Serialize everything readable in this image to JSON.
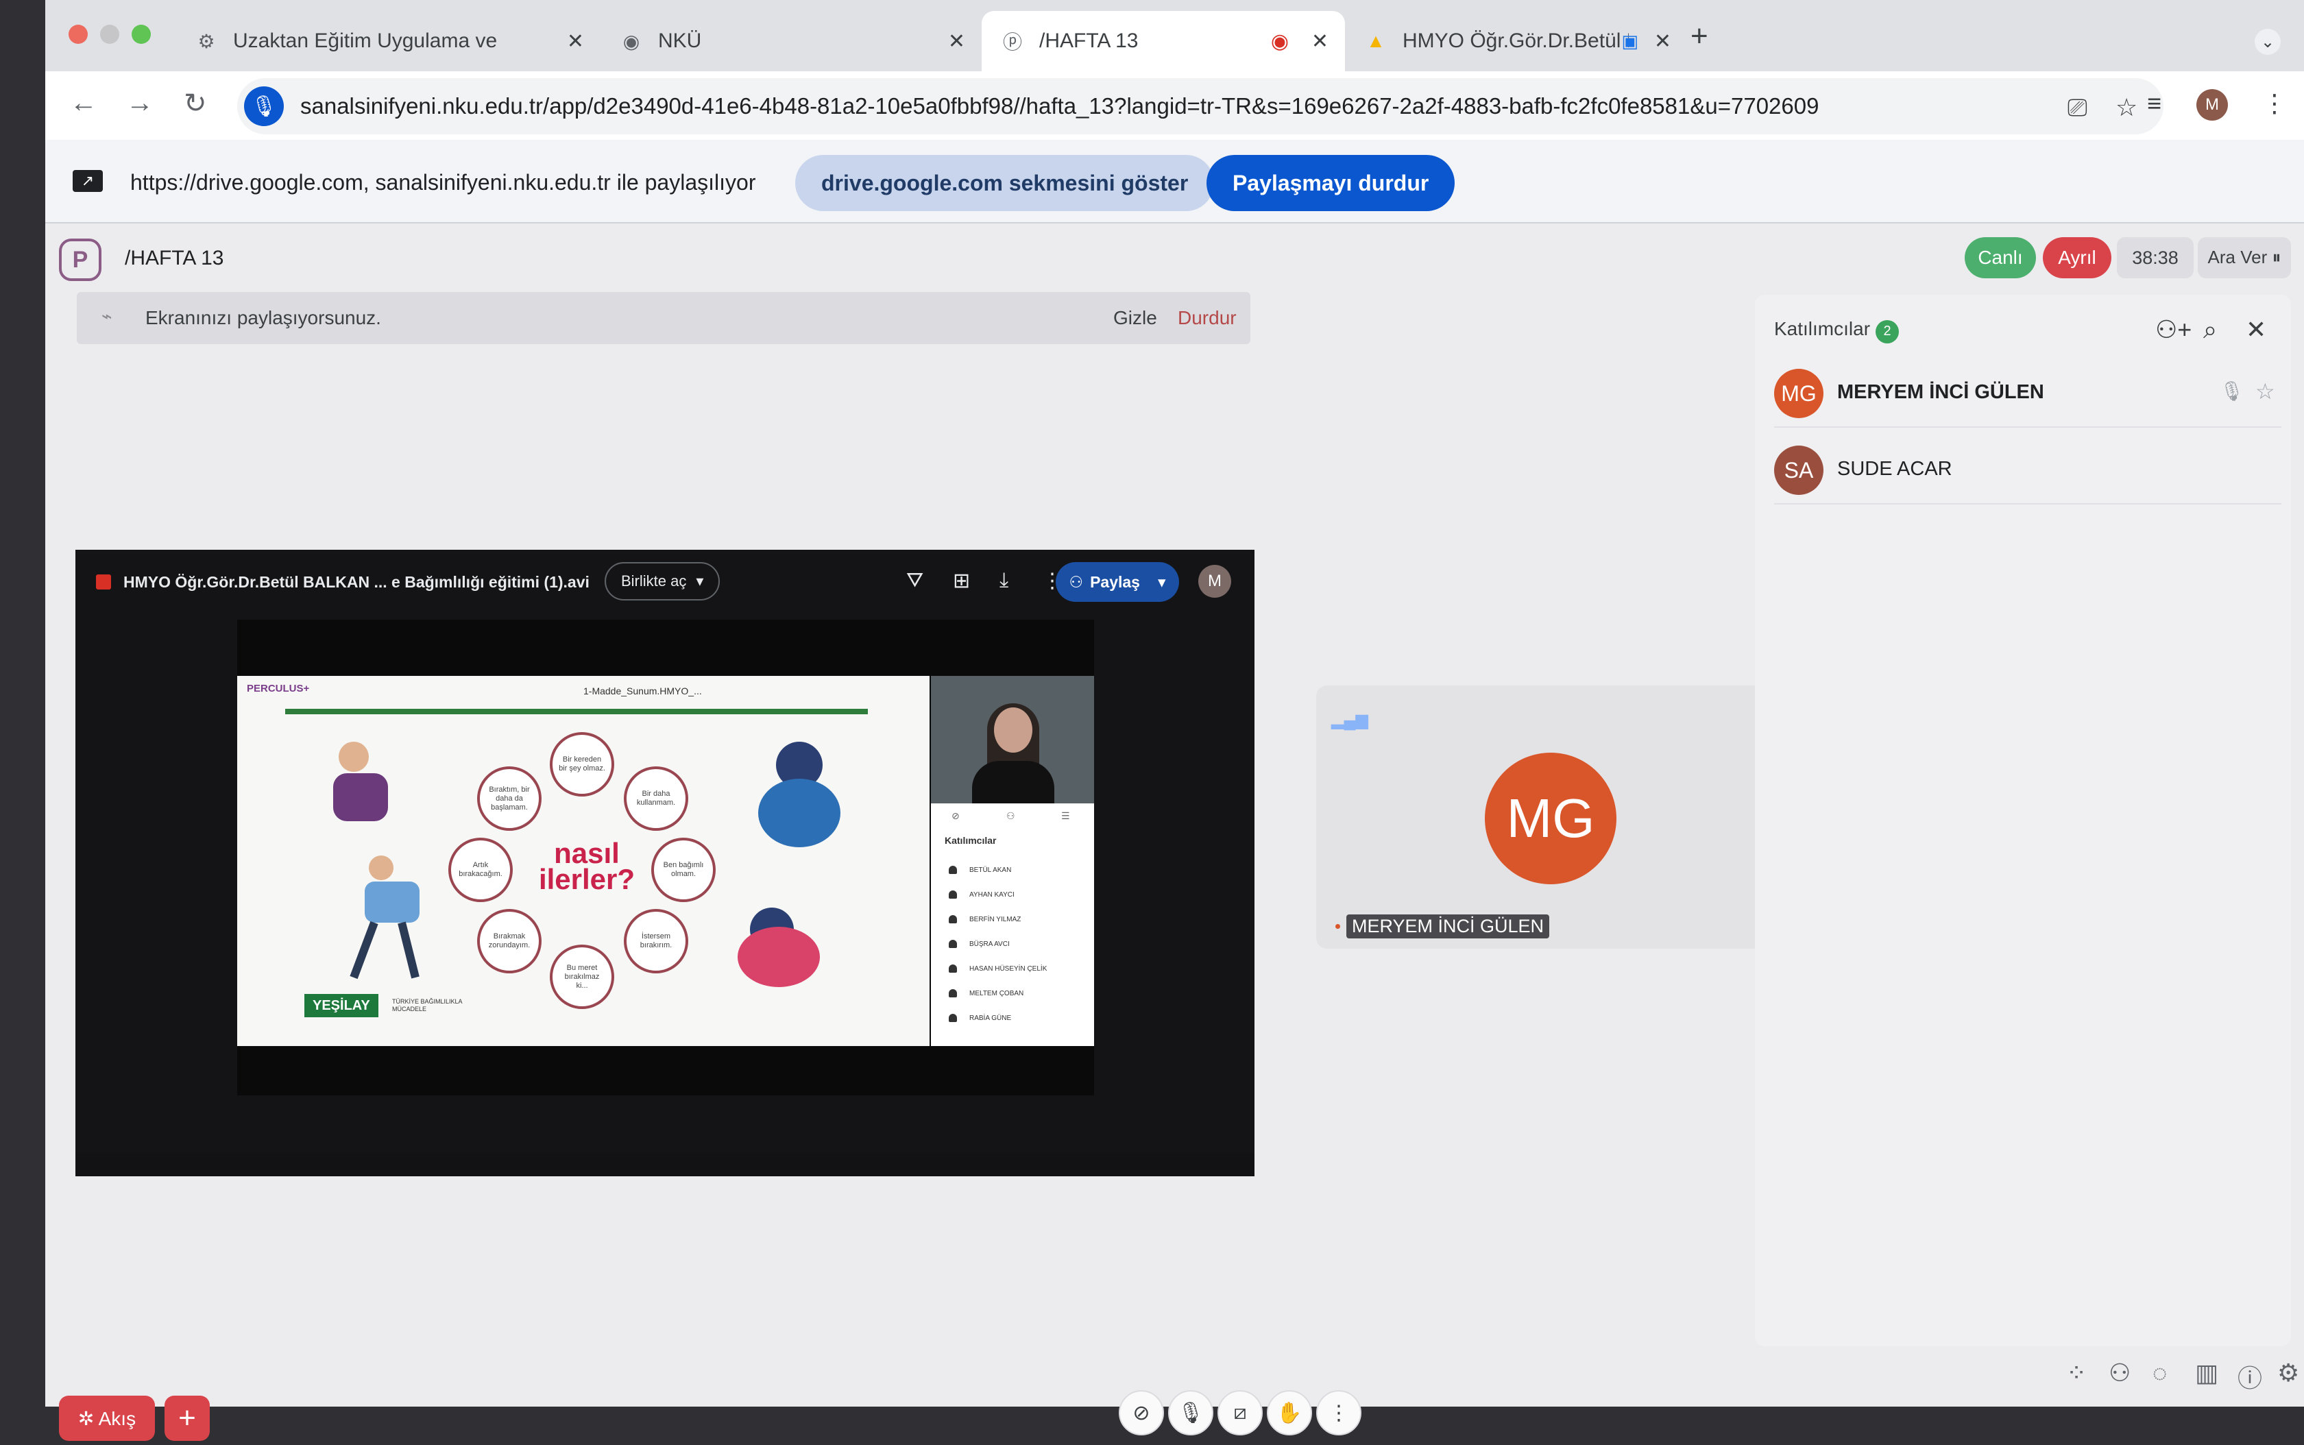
{
  "window": {
    "traffic_colors": [
      "#ed6a5e",
      "#c6c6c8",
      "#c6c6c8"
    ]
  },
  "tabs": [
    {
      "label": "Uzaktan Eğitim Uygulama ve",
      "icon": "gear-icon"
    },
    {
      "label": "NKÜ",
      "icon": "nku-icon"
    },
    {
      "label": "/HAFTA 13",
      "icon": "perculus-icon",
      "active": true,
      "recording": true
    },
    {
      "label": "HMYO Öğr.Gör.Dr.Betül B",
      "icon": "drive-icon"
    }
  ],
  "addressbar": {
    "url": "sanalsinifyeni.nku.edu.tr/app/d2e3490d-41e6-4b48-81a2-10e5a0fbbf98//hafta_13?langid=tr-TR&s=169e6267-2a2f-4883-bafb-fc2fc0fe8581&u=7702609",
    "profile_initial": "M"
  },
  "sharebar": {
    "text": "https://drive.google.com, sanalsinifyeni.nku.edu.tr ile paylaşılıyor",
    "show_tab_label": "drive.google.com sekmesini göster",
    "stop_sharing_label": "Paylaşmayı durdur"
  },
  "app": {
    "title": "/HAFTA 13",
    "live_label": "Canlı",
    "live_color": "#4caf6e",
    "separate_label": "Ayrıl",
    "separate_color": "#d9434a",
    "timer": "38:38",
    "break_label": "Ara Ver ⏸",
    "notice": {
      "text": "Ekranınızı paylaşıyorsunuz.",
      "hide_label": "Gizle",
      "stop_label": "Durdur"
    }
  },
  "shared_screen": {
    "file_title": "HMYO Öğr.Gör.Dr.Betül BALKAN ... e Bağımlılığı eğitimi (1).avi",
    "open_with_label": "Birlikte aç",
    "share_label": "Paylaş",
    "avatar_initial": "M",
    "slide": {
      "brand": "PERCULUS+",
      "doc_title": "1-Madde_Sunum.HMYO_...",
      "headline": "nasıl ilerler?",
      "bubbles": [
        "Bir kereden bir şey olmaz.",
        "Bir daha kullanmam.",
        "Ben bağımlı olmam.",
        "İstersem bırakırım.",
        "Bu meret bırakılmaz ki...",
        "Bırakmak zorundayım.",
        "Artık bırakacağım.",
        "Bıraktım, bir daha da başlamam."
      ],
      "logo": "YEŞİLAY",
      "logo_sub": "TÜRKİYE BAĞIMLILIKLA MÜCADELE"
    },
    "mini_participants": {
      "title": "Katılımcılar",
      "names": [
        "BETÜL AKAN",
        "AYHAN KAYCI",
        "BERFİN YILMAZ",
        "BÜŞRA AVCI",
        "HASAN HÜSEYİN ÇELİK",
        "MELTEM ÇOBAN",
        "RABİA GÜNE"
      ]
    }
  },
  "video_tile": {
    "initials": "MG",
    "name": "MERYEM İNCİ GÜLEN",
    "color": "#d9562b"
  },
  "participants": {
    "title": "Katılımcılar",
    "count": "2",
    "items": [
      {
        "initials": "MG",
        "name": "MERYEM İNCİ GÜLEN",
        "color": "#d9562b"
      },
      {
        "initials": "SA",
        "name": "SUDE ACAR",
        "color": "#9a4e3e"
      }
    ]
  },
  "bottom": {
    "flow_label": "✲ Akış",
    "add_label": "+"
  }
}
